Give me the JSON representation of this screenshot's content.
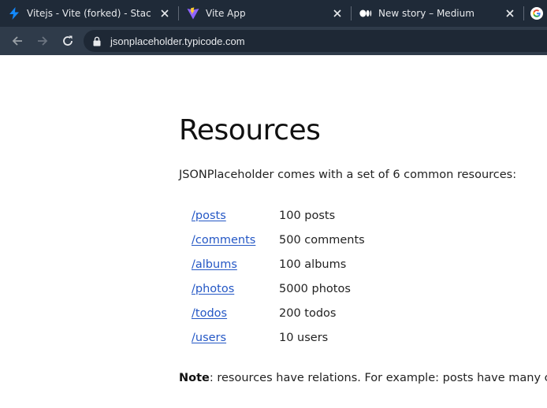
{
  "tabs": [
    {
      "title": "Vitejs - Vite (forked) - StackBl",
      "favicon": "lightning-bolt-icon",
      "active": false
    },
    {
      "title": "Vite App",
      "favicon": "vite-logo-icon",
      "active": false
    },
    {
      "title": "New story – Medium",
      "favicon": "medium-logo-icon",
      "active": false
    },
    {
      "title": "",
      "favicon": "google-logo-icon",
      "active": false
    }
  ],
  "toolbar": {
    "url": "jsonplaceholder.typicode.com",
    "icons": [
      "back-arrow-icon",
      "forward-arrow-icon",
      "reload-icon",
      "lock-icon"
    ]
  },
  "page": {
    "heading": "Resources",
    "intro": "JSONPlaceholder comes with a set of 6 common resources:",
    "resources": [
      {
        "path": "/posts",
        "count": "100 posts"
      },
      {
        "path": "/comments",
        "count": "500 comments"
      },
      {
        "path": "/albums",
        "count": "100 albums"
      },
      {
        "path": "/photos",
        "count": "5000 photos"
      },
      {
        "path": "/todos",
        "count": "200 todos"
      },
      {
        "path": "/users",
        "count": "10 users"
      }
    ],
    "note_label": "Note",
    "note_text": ": resources have relations. For example: posts have many comm"
  },
  "colors": {
    "tabstrip_bg": "#1f2a38",
    "toolbar_bg": "#2f3b4a",
    "omnibox_bg": "#1e2835",
    "link": "#2457c5",
    "stackblitz_bolt": "#1389fd",
    "vite_purple": "#8f63ff",
    "vite_yellow": "#ffcb2f"
  }
}
